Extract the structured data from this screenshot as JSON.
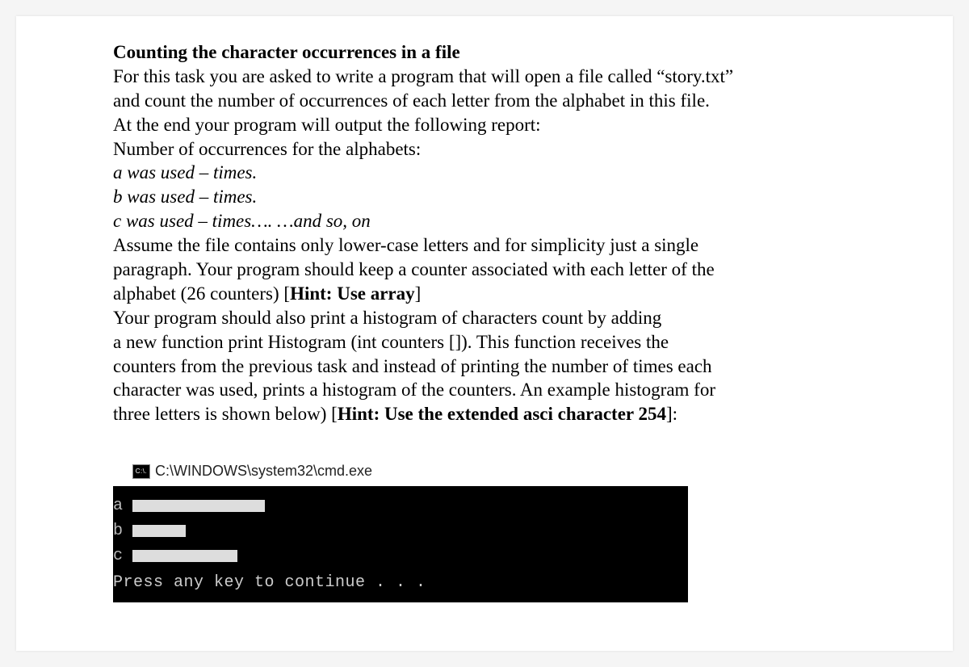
{
  "title": "Counting the character occurrences in a file",
  "paragraph1_line1": "For this task you are asked to write a program that will open a file called “story.txt”",
  "paragraph1_line2": "and count the number of occurrences of each letter from the alphabet in this file.",
  "paragraph1_line3": "At the end your program will output the following report:",
  "paragraph1_line4": "Number of occurrences for the alphabets:",
  "italic_a": "a was used – times.",
  "italic_b": "b was used – times.",
  "italic_c": "c was used – times…. …and so, on",
  "paragraph2_line1": "Assume the file contains only lower-case letters and for simplicity just a single",
  "paragraph2_line2": "paragraph. Your program should keep a counter associated with each letter of the",
  "paragraph2_line3_a": "alphabet (26 counters) [",
  "paragraph2_line3_b": "Hint: Use array",
  "paragraph2_line3_c": "]",
  "paragraph3_line1": "Your program should also print a histogram of characters count by adding",
  "paragraph3_line2": " a new function print Histogram (int counters []). This function receives the",
  "paragraph3_line3": "counters from the previous task and instead of printing the number of times each",
  "paragraph3_line4": "character was used, prints a histogram of the counters. An example histogram for",
  "paragraph3_line5_a": "three letters is shown below) [",
  "paragraph3_line5_b": "Hint: Use the extended asci character 254",
  "paragraph3_line5_c": "]:",
  "console": {
    "icon_text": "C:\\.",
    "title": "C:\\WINDOWS\\system32\\cmd.exe",
    "rows": {
      "a": "a",
      "b": "b",
      "c": "c"
    },
    "press_key": "Press any key to continue . . ."
  }
}
